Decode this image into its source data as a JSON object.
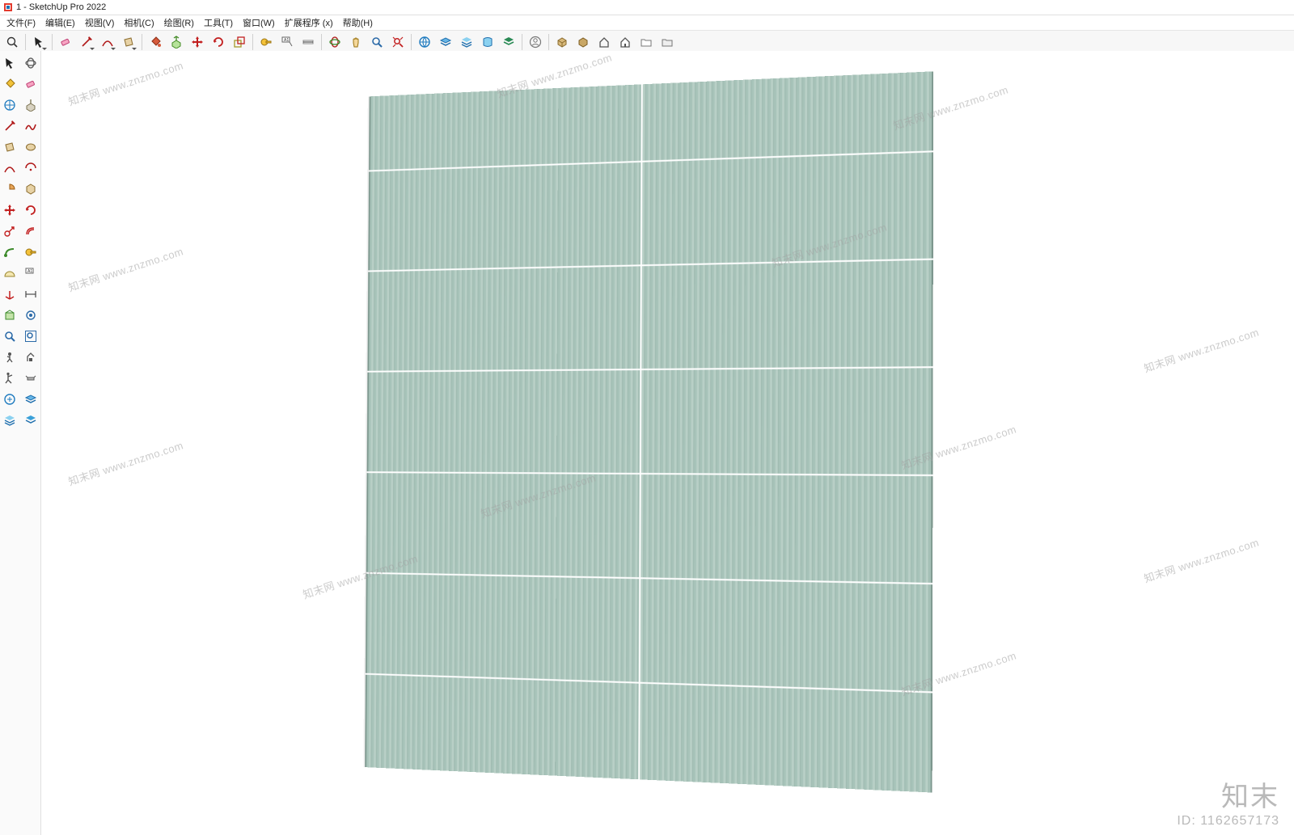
{
  "window": {
    "title": "1 - SketchUp Pro 2022"
  },
  "menu": {
    "file": "文件(F)",
    "edit": "编辑(E)",
    "view": "视图(V)",
    "camera": "相机(C)",
    "draw": "绘图(R)",
    "tools": "工具(T)",
    "window": "窗口(W)",
    "extensions": "扩展程序 (x)",
    "help": "帮助(H)"
  },
  "watermark": {
    "repeat": "知末网 www.znzmo.com",
    "brand": "知末",
    "id_label": "ID: 1162657173"
  },
  "icons": {
    "app": "sketchup-icon",
    "h": [
      "search-icon",
      "select-icon",
      "eraser-icon",
      "line-icon",
      "freehand-icon",
      "arc-icon",
      "rectangle-icon",
      "circle-icon",
      "polygon-icon",
      "paint-bucket-icon",
      "push-pull-icon",
      "move-icon",
      "rotate-icon",
      "scale-icon",
      "offset-icon",
      "tape-measure-icon",
      "text-label-icon",
      "dimension-icon",
      "axes-icon",
      "protractor-icon",
      "orbit-icon",
      "pan-icon",
      "zoom-icon",
      "zoom-extents-icon",
      "warehouse-icon",
      "layers-icon",
      "outliner-icon",
      "styles-icon",
      "scenes-icon",
      "user-icon",
      "component-icon",
      "box-icon",
      "house-icon",
      "folder-open-icon",
      "folder-icon",
      "folder-new-icon"
    ],
    "l": [
      [
        "select-icon",
        "orbit-icon"
      ],
      [
        "paint-bucket-icon",
        "eraser-icon"
      ],
      [
        "components-icon",
        "push-pull-large-icon"
      ],
      [
        "line-icon",
        "freehand-red-icon"
      ],
      [
        "rectangle-tan-icon",
        "circle-tan-icon"
      ],
      [
        "arc-red-icon",
        "arc2-icon"
      ],
      [
        "pie-icon",
        "polygon-tan-icon"
      ],
      [
        "move-icon",
        "rotate-red-icon"
      ],
      [
        "scale-red-icon",
        "offset-red-icon"
      ],
      [
        "follow-me-icon",
        "tape-measure-icon"
      ],
      [
        "protractor-icon",
        "text-label-icon"
      ],
      [
        "axes-red-icon",
        "dim-icon"
      ],
      [
        "section-icon",
        "camera-walk-icon"
      ],
      [
        "look-around-icon",
        "zoom-icon"
      ],
      [
        "zoom-window-icon",
        "zoom-extents-icon"
      ],
      [
        "prev-view-icon",
        "next-view-icon"
      ],
      [
        "position-camera-icon",
        "walk-icon"
      ],
      [
        "warehouse-blue-icon",
        "layers-blue-icon"
      ],
      [
        "styles-blue-icon",
        "scenes-blue-icon"
      ]
    ]
  }
}
